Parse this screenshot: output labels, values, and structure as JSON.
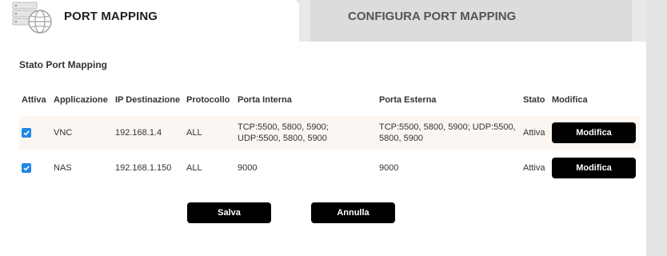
{
  "tabs": {
    "active_label": "PORT MAPPING",
    "inactive_label": "CONFIGURA PORT MAPPING",
    "icon": "server-globe-icon"
  },
  "section_title": "Stato Port Mapping",
  "table": {
    "headers": [
      "Attiva",
      "Applicazione",
      "IP Destinazione",
      "Protocollo",
      "Porta Interna",
      "Porta Esterna",
      "Stato",
      "Modifica"
    ],
    "rows": [
      {
        "checked": true,
        "application": "VNC",
        "ip": "192.168.1.4",
        "protocol": "ALL",
        "internal_port_l1": "TCP:5500, 5800, 5900;",
        "internal_port_l2": "UDP:5500, 5800, 5900",
        "external_port_l1": "TCP:5500, 5800, 5900; UDP:5500,",
        "external_port_l2": "5800, 5900",
        "status": "Attiva",
        "edit_label": "Modifica"
      },
      {
        "checked": true,
        "application": "NAS",
        "ip": "192.168.1.150",
        "protocol": "ALL",
        "internal_port_l1": "9000",
        "internal_port_l2": "",
        "external_port_l1": "9000",
        "external_port_l2": "",
        "status": "Attiva",
        "edit_label": "Modifica"
      }
    ]
  },
  "actions": {
    "save_label": "Salva",
    "cancel_label": "Annulla"
  },
  "colors": {
    "accent_checkbox": "#1e88e5",
    "button_bg": "#000000",
    "row_highlight": "#fbf6f2"
  }
}
